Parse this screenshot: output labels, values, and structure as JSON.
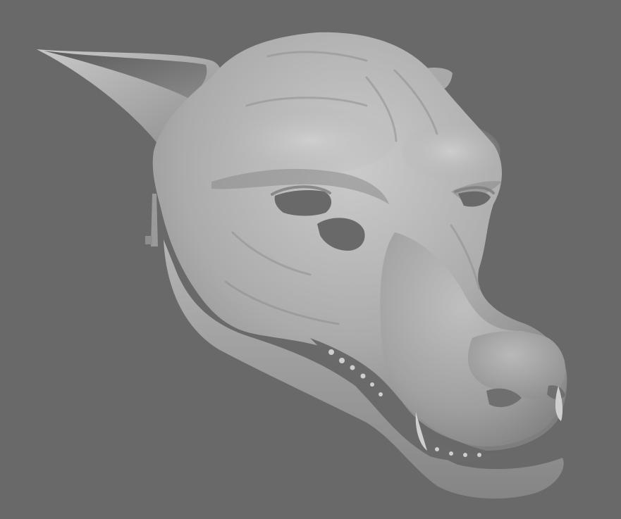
{
  "viewport": {
    "background_color": "#696969",
    "model_subject": "wolf-head-mask",
    "render_style": "clay-matcap",
    "clay_light": "#c4c4c4",
    "clay_mid": "#a3a3a3",
    "clay_shadow": "#6f6f6f",
    "clay_deep": "#4f4f4f"
  }
}
